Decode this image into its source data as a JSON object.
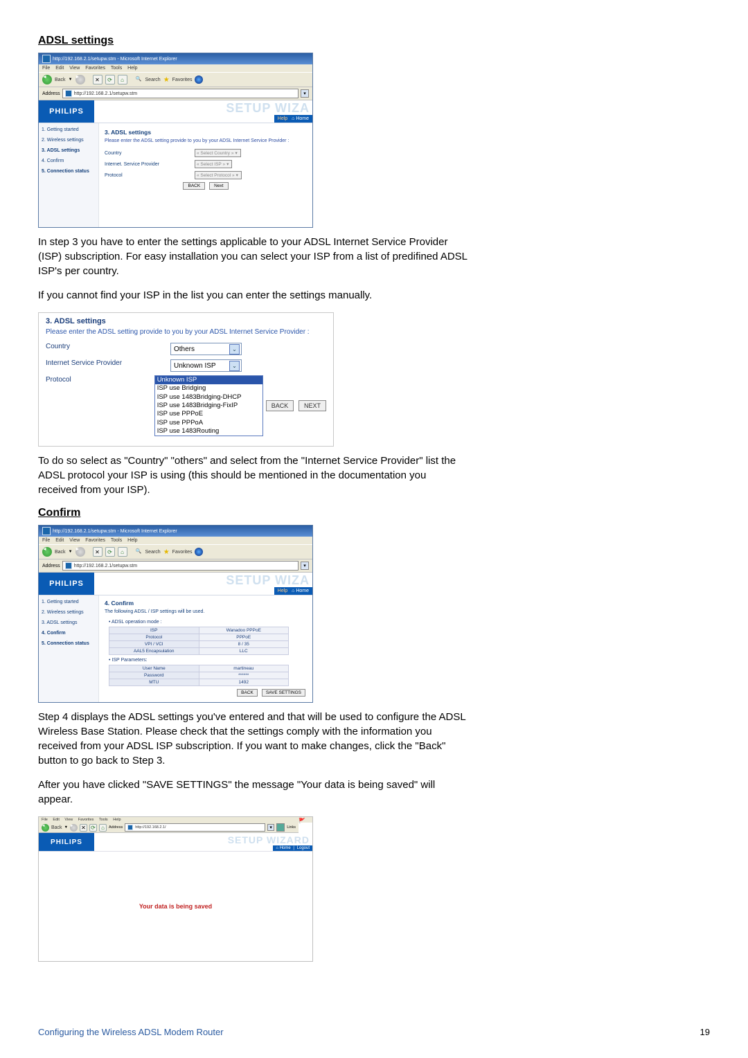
{
  "sections": {
    "adsl_heading": "ADSL settings",
    "confirm_heading": "Confirm"
  },
  "paragraphs": {
    "adsl_p1": "In step 3 you have to enter the settings applicable to your ADSL Internet Service Provider (ISP) subscription. For easy installation you can select your ISP from a list of predifined ADSL ISP's per country.",
    "adsl_p2": "If you cannot find your ISP in the list you can enter the settings manually.",
    "adsl_p3": "To do so select as \"Country\" \"others\" and select from the \"Internet Service Provider\" list the ADSL protocol your ISP is using (this should be mentioned in the documentation you received from your ISP).",
    "conf_p1": "Step 4 displays the ADSL settings you've entered and that will be used to configure the ADSL Wireless Base Station. Please check that the settings comply with the information you received from your ADSL ISP subscription. If you want to make changes, click the \"Back\" button to go back to Step 3.",
    "conf_p2": "After you have clicked \"SAVE SETTINGS\" the message \"Your data is being saved\" will appear."
  },
  "ie": {
    "title": "http://192.168.2.1/setupw.stm - Microsoft Internet Explorer",
    "menu": {
      "file": "File",
      "edit": "Edit",
      "view": "View",
      "favorites": "Favorites",
      "tools": "Tools",
      "help": "Help"
    },
    "back": "Back",
    "search": "Search",
    "favorites_btn": "Favorites",
    "addr_label": "Address",
    "addr_value": "http://192.168.2.1/setupw.stm"
  },
  "philips": {
    "logo": "PHILIPS",
    "setup_title": "SETUP WIZA",
    "setup_title_full": "SETUP WIZARD",
    "tab_help": "Help",
    "tab_home": "Home",
    "tab_logout": "Logout"
  },
  "wizard_side": {
    "s1": "1. Getting started",
    "s2": "2. Wireless settings",
    "s3": "3. ADSL settings",
    "s4": "4. Confirm",
    "s5": "5. Connection status"
  },
  "adsl_scr": {
    "title": "3. ADSL settings",
    "instr": "Please enter the ADSL setting provide to you by your ADSL Internet Service Provider :",
    "country": "Country",
    "isp": "Internet. Service Provider",
    "protocol": "Protocol",
    "sel_country": "« Select Country »",
    "sel_isp": "« Select ISP »",
    "sel_proto": "« Select Protocol »",
    "back": "BACK",
    "next": "Next"
  },
  "adsl_pane": {
    "title": "3. ADSL settings",
    "instr": "Please enter the ADSL setting provide to you by your ADSL Internet Service Provider :",
    "country": "Country",
    "isp": "Internet Service Provider",
    "protocol": "Protocol",
    "country_val": "Others",
    "isp_val": "Unknown ISP",
    "opts": {
      "o0": "Unknown ISP",
      "o1": "ISP use Bridging",
      "o2": "ISP use 1483Bridging-DHCP",
      "o3": "ISP use 1483Bridging-FixIP",
      "o4": "ISP use PPPoE",
      "o5": "ISP use PPPoA",
      "o6": "ISP use 1483Routing"
    },
    "back": "BACK",
    "next": "NEXT"
  },
  "confirm_scr": {
    "title": "4. Confirm",
    "instr": "The following ADSL / ISP settings will be used.",
    "b1": "ADSL operation mode :",
    "tbl1": {
      "isp_l": "ISP",
      "isp_v": "Wanadoo PPPoE",
      "proto_l": "Protocol",
      "proto_v": "PPPoE",
      "vpi_l": "VPI / VCI",
      "vpi_v": "8 / 35",
      "enc_l": "AAL5 Encapsulation",
      "enc_v": "LLC"
    },
    "b2": "ISP Parameters:",
    "tbl2": {
      "un_l": "User Name",
      "un_v": "martineau",
      "pw_l": "Password",
      "pw_v": "******",
      "mtu_l": "MTU",
      "mtu_v": "1492"
    },
    "back": "BACK",
    "save": "SAVE SETTINGS"
  },
  "saving": {
    "addr": "http://192.168.2.1/",
    "links": "Links",
    "msg": "Your data is being saved"
  },
  "footer": {
    "left": "Configuring the Wireless ADSL Modem Router",
    "page": "19"
  }
}
